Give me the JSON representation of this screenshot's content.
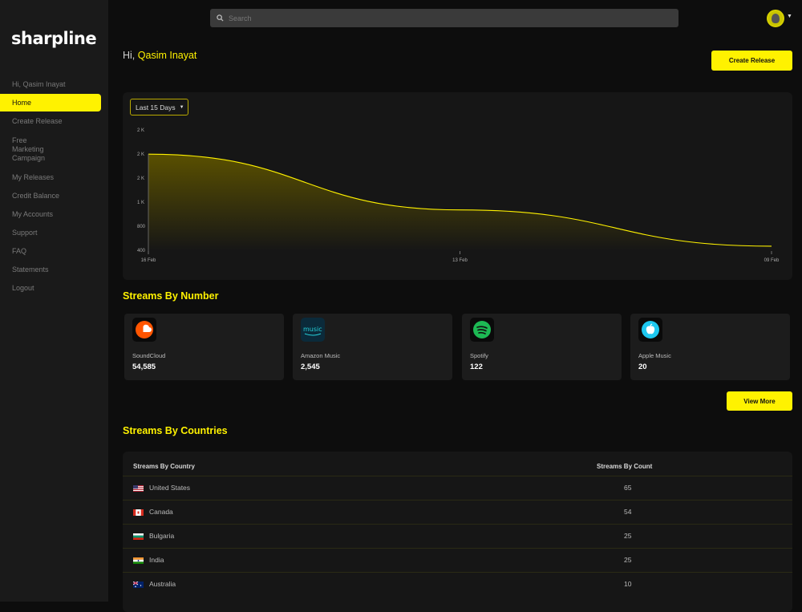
{
  "brand": {
    "logo": "sharpline"
  },
  "sidebar": {
    "greeting": "Hi, Qasim Inayat",
    "items": [
      {
        "label": "Home",
        "active": true
      },
      {
        "label": "Create Release"
      },
      {
        "label": "Free Marketing Campaign"
      },
      {
        "label": "My Releases"
      },
      {
        "label": "Credit Balance"
      },
      {
        "label": "My Accounts"
      },
      {
        "label": "Support"
      },
      {
        "label": "FAQ"
      },
      {
        "label": "Statements"
      },
      {
        "label": "Logout"
      }
    ]
  },
  "header": {
    "search_placeholder": "Search",
    "search_icon": "search-icon",
    "avatar_icon": "user-avatar"
  },
  "welcome": {
    "prefix": "Hi,",
    "name": "Qasim Inayat"
  },
  "actions": {
    "create_release": "Create Release",
    "view_more": "View More"
  },
  "filter": {
    "range_label": "Last 15 Days"
  },
  "chart_data": {
    "type": "area",
    "x": [
      "16 Feb",
      "13 Feb",
      "09 Feb"
    ],
    "y_ticks": [
      "2 K",
      "2 K",
      "2 K",
      "1 K",
      "800",
      "400"
    ],
    "series": [
      {
        "values": [
          2000,
          1080,
          480
        ]
      }
    ],
    "grid": false,
    "colors": {
      "line": "#fff200",
      "fill_top": "#5a5000",
      "fill_bottom": "#161616"
    }
  },
  "streams": {
    "title": "Streams By Number",
    "items": [
      {
        "name": "SoundCloud",
        "count": "54,585",
        "icon": "soundcloud-icon",
        "color": "#ff5500"
      },
      {
        "name": "Amazon Music",
        "count": "2,545",
        "icon": "amazon-music-icon",
        "color": "#25d1da"
      },
      {
        "name": "Spotify",
        "count": "122",
        "icon": "spotify-icon",
        "color": "#1db954"
      },
      {
        "name": "Apple Music",
        "count": "20",
        "icon": "apple-music-icon",
        "color": "#1ec8f0"
      }
    ]
  },
  "countries": {
    "title": "Streams By Countries",
    "col_country": "Streams By Country",
    "col_count": "Streams By Count",
    "rows": [
      {
        "country": "United States",
        "count": "65",
        "flag": "us-flag"
      },
      {
        "country": "Canada",
        "count": "54",
        "flag": "canada-flag"
      },
      {
        "country": "Bulgaria",
        "count": "25",
        "flag": "bulgaria-flag"
      },
      {
        "country": "India",
        "count": "25",
        "flag": "india-flag"
      },
      {
        "country": "Australia",
        "count": "10",
        "flag": "australia-flag"
      }
    ]
  },
  "accent": "#fff200"
}
